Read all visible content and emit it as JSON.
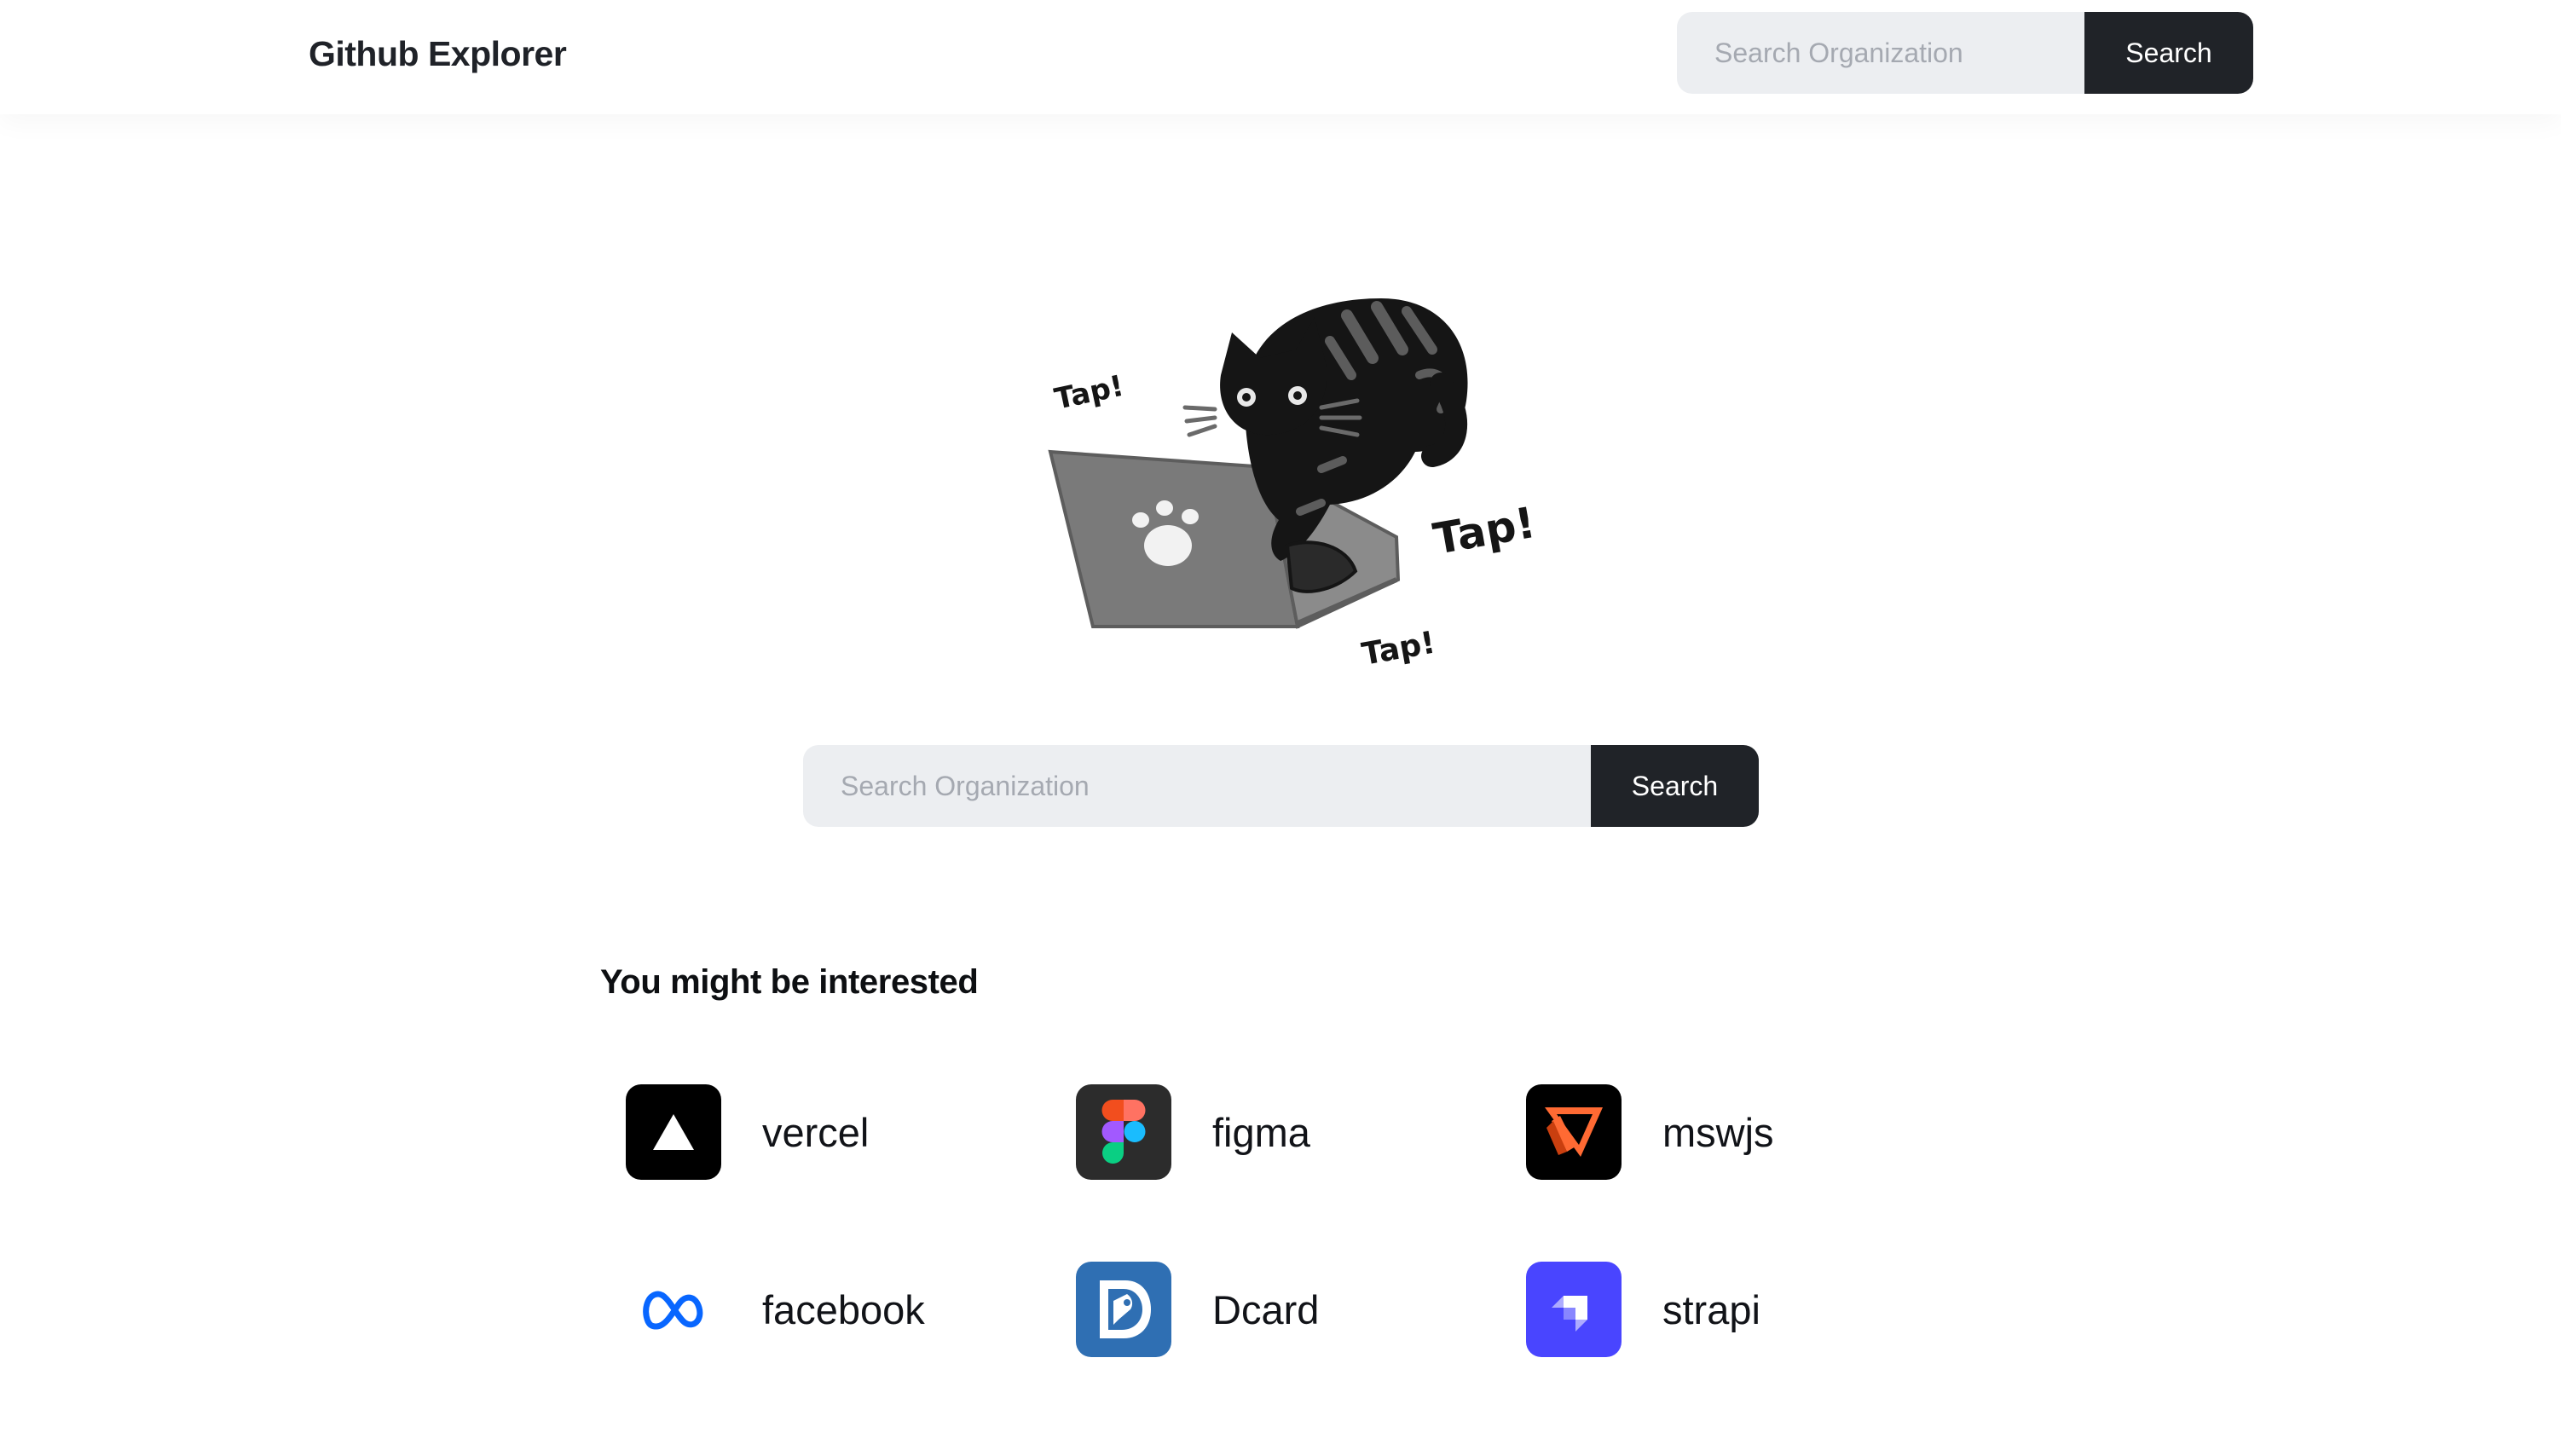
{
  "header": {
    "brand": "Github Explorer",
    "search": {
      "placeholder": "Search Organization",
      "value": "",
      "button_label": "Search"
    }
  },
  "hero": {
    "illustration": {
      "icon": "cat-typing-on-laptop-illustration",
      "tap_texts": [
        "Tap!",
        "Tap!",
        "Tap!"
      ]
    },
    "search": {
      "placeholder": "Search Organization",
      "value": "",
      "button_label": "Search"
    }
  },
  "suggestions": {
    "title": "You might be interested",
    "orgs": [
      {
        "name": "vercel",
        "icon": "vercel-logo-icon",
        "color": "#000000"
      },
      {
        "name": "figma",
        "icon": "figma-logo-icon",
        "color": "#2c2c2c"
      },
      {
        "name": "mswjs",
        "icon": "mswjs-logo-icon",
        "color": "#000000"
      },
      {
        "name": "facebook",
        "icon": "meta-logo-icon",
        "color": "#0866ff"
      },
      {
        "name": "Dcard",
        "icon": "dcard-logo-icon",
        "color": "#2f6fb3"
      },
      {
        "name": "strapi",
        "icon": "strapi-logo-icon",
        "color": "#4945ff"
      }
    ]
  },
  "colors": {
    "button_bg": "#202328",
    "input_bg": "#eceef1",
    "placeholder": "#a5a9b1"
  }
}
